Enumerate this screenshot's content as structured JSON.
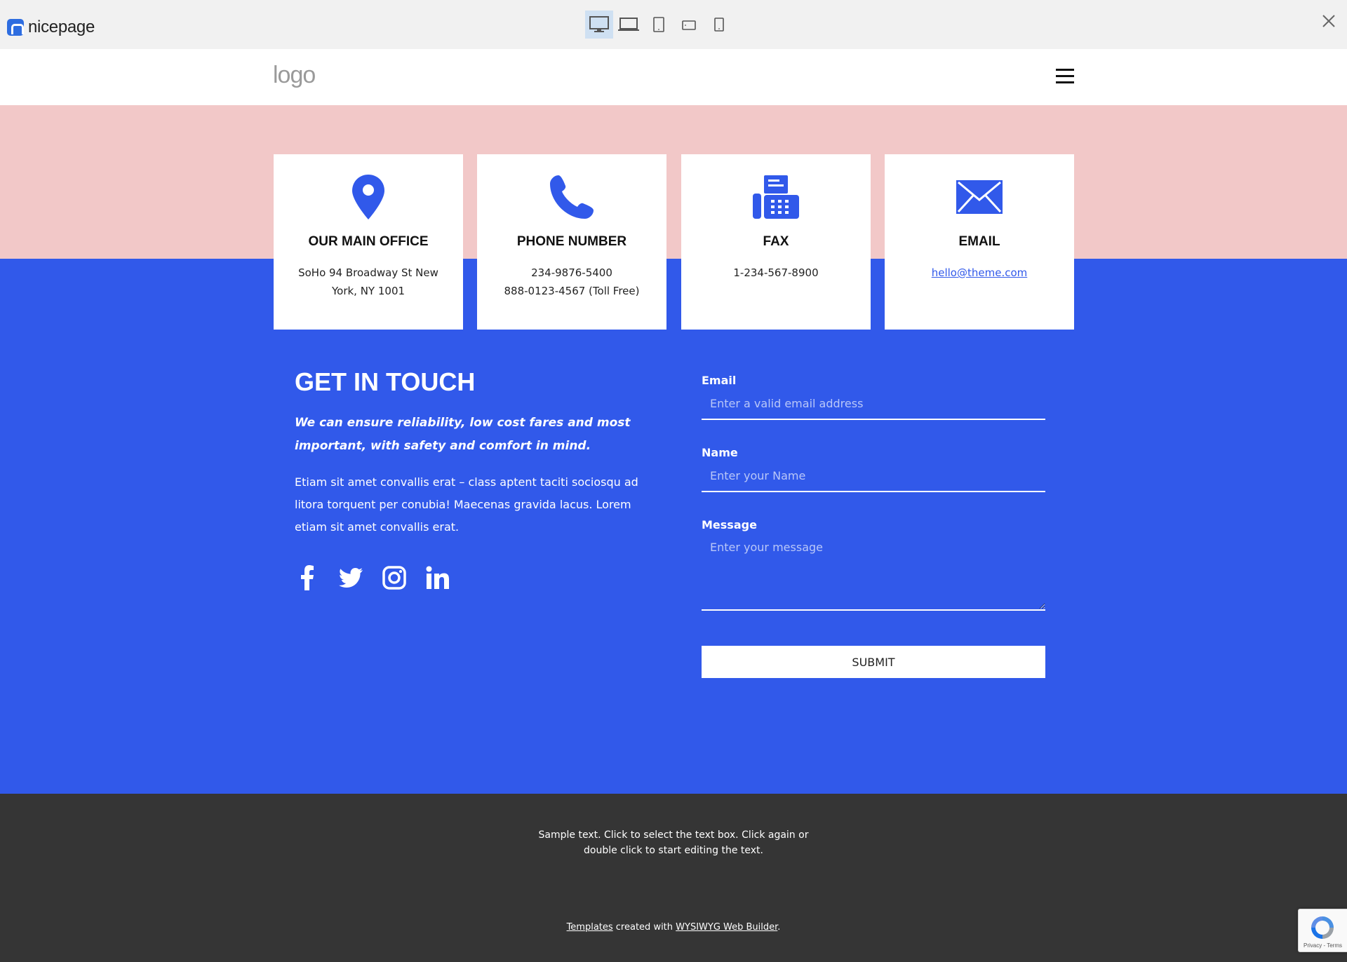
{
  "preview_toolbar": {
    "brand": "nicepage",
    "devices": [
      {
        "icon": "desktop-icon",
        "active": true
      },
      {
        "icon": "laptop-icon",
        "active": false
      },
      {
        "icon": "tablet-icon",
        "active": false
      },
      {
        "icon": "tablet-landscape-icon",
        "active": false
      },
      {
        "icon": "phone-icon",
        "active": false
      }
    ],
    "close_icon": "close-icon"
  },
  "header": {
    "logo_text": "logo",
    "menu_icon": "hamburger-menu-icon"
  },
  "colors": {
    "pink_band": "#f2c8c8",
    "blue_section": "#3159ea",
    "footer": "#353535",
    "accent": "#3159ea"
  },
  "cards": [
    {
      "icon": "map-pin-icon",
      "title": "OUR MAIN OFFICE",
      "lines": [
        "SoHo 94 Broadway St New",
        "York, NY 1001"
      ]
    },
    {
      "icon": "phone-icon",
      "title": "PHONE NUMBER",
      "lines": [
        "234-9876-5400",
        "888-0123-4567 (Toll Free)"
      ]
    },
    {
      "icon": "fax-icon",
      "title": "FAX",
      "lines": [
        "1-234-567-8900"
      ]
    },
    {
      "icon": "envelope-icon",
      "title": "EMAIL",
      "link": "hello@theme.com"
    }
  ],
  "contact": {
    "title": "GET IN TOUCH",
    "lead": "We can ensure reliability, low cost fares and most important, with safety and comfort in mind.",
    "body": "Etiam sit amet convallis erat – class aptent taciti sociosqu ad litora torquent per conubia! Maecenas gravida lacus. Lorem etiam sit amet convallis erat.",
    "social": [
      "facebook-icon",
      "twitter-icon",
      "instagram-icon",
      "linkedin-icon"
    ]
  },
  "form": {
    "email_label": "Email",
    "email_placeholder": "Enter a valid email address",
    "name_label": "Name",
    "name_placeholder": "Enter your Name",
    "message_label": "Message",
    "message_placeholder": "Enter your message",
    "submit_label": "SUBMIT"
  },
  "footer": {
    "sample_text": "Sample text. Click to select the text box. Click again or double click to start editing the text.",
    "credit_link1": "Templates",
    "credit_mid": " created with ",
    "credit_link2": "WYSIWYG Web Builder",
    "credit_end": "."
  },
  "recaptcha": {
    "text": "Privacy - Terms"
  }
}
